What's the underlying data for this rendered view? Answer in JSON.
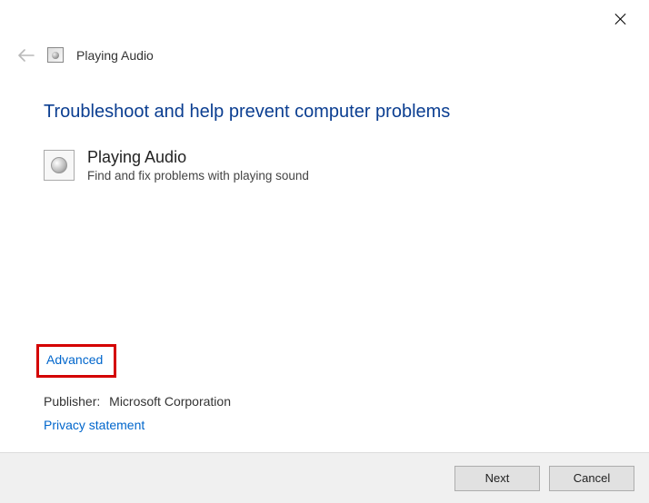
{
  "window": {
    "title": "Playing Audio"
  },
  "heading": "Troubleshoot and help prevent computer problems",
  "troubleshooter": {
    "title": "Playing Audio",
    "description": "Find and fix problems with playing sound"
  },
  "links": {
    "advanced": "Advanced",
    "privacy": "Privacy statement"
  },
  "publisher": {
    "label": "Publisher:",
    "value": "Microsoft Corporation"
  },
  "buttons": {
    "next": "Next",
    "cancel": "Cancel"
  }
}
